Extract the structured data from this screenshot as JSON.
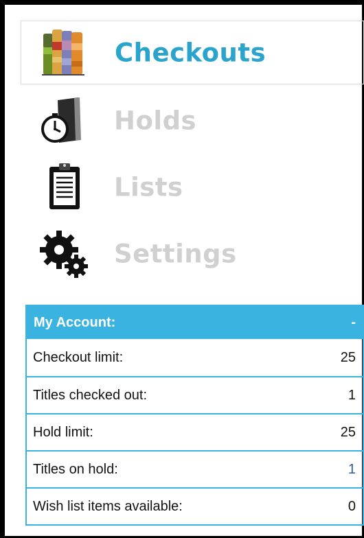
{
  "nav": {
    "items": [
      {
        "label": "Checkouts",
        "icon": "books-icon",
        "active": true
      },
      {
        "label": "Holds",
        "icon": "stopwatch-book-icon",
        "active": false
      },
      {
        "label": "Lists",
        "icon": "clipboard-icon",
        "active": false
      },
      {
        "label": "Settings",
        "icon": "gears-icon",
        "active": false
      }
    ]
  },
  "account": {
    "title": "My Account:",
    "toggle": "-",
    "rows": [
      {
        "label": "Checkout limit:",
        "value": "25"
      },
      {
        "label": "Titles checked out:",
        "value": "1"
      },
      {
        "label": "Hold limit:",
        "value": "25"
      },
      {
        "label": "Titles on hold:",
        "value": "1"
      },
      {
        "label": "Wish list items available:",
        "value": "0"
      }
    ]
  },
  "colors": {
    "accent": "#3ab3e1",
    "active_label": "#2aa4cc",
    "inactive_label": "#d0d0d0"
  }
}
